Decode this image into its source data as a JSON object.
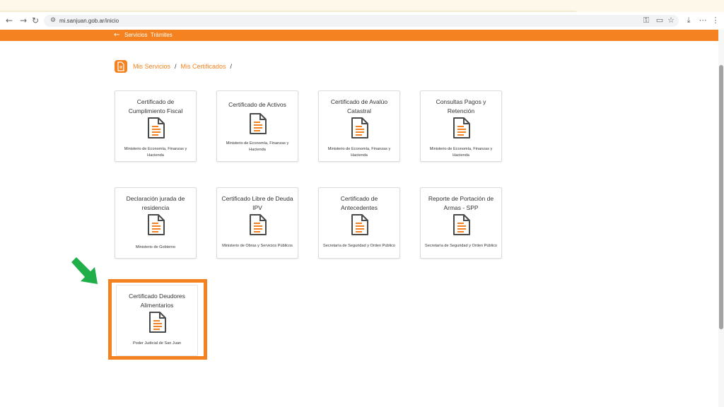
{
  "browser": {
    "url": "mi.sanjuan.gob.ar/inicio"
  },
  "site_header": {
    "back_label": "Servicios",
    "section_label": "Trámites"
  },
  "breadcrumb": {
    "items": [
      "Mis Servicios",
      "Mis Certificados"
    ],
    "separator": "/"
  },
  "cards": [
    {
      "title": "Certificado de Cumplimiento Fiscal",
      "org": "Ministerio de Economía, Finanzas y Hacienda"
    },
    {
      "title": "Certificado de Activos",
      "org": "Ministerio de Economía, Finanzas y Hacienda"
    },
    {
      "title": "Certificado de Avalúo Catastral",
      "org": "Ministerio de Economía, Finanzas y Hacienda"
    },
    {
      "title": "Consultas Pagos y Retención",
      "org": "Ministerio de Economía, Finanzas y Hacienda"
    },
    {
      "title": "Declaración jurada de residencia",
      "org": "Ministerio de Gobierno"
    },
    {
      "title": "Certificado Libre de Deuda IPV",
      "org": "Ministerio de Obras y Servicios Públicos"
    },
    {
      "title": "Certificado de Antecedentes",
      "org": "Secretaría de Seguridad y Orden Público"
    },
    {
      "title": "Reporte de Portación de Armas - SPP",
      "org": "Secretaría de Seguridad y Orden Público"
    },
    {
      "title": "Certificado Deudores Alimentarios",
      "org": "Poder Judicial de San Juan"
    }
  ],
  "colors": {
    "accent": "#f58220",
    "arrow": "#1fae48"
  },
  "icons": {
    "card": "document-icon",
    "annotation": "green-arrow-icon"
  }
}
